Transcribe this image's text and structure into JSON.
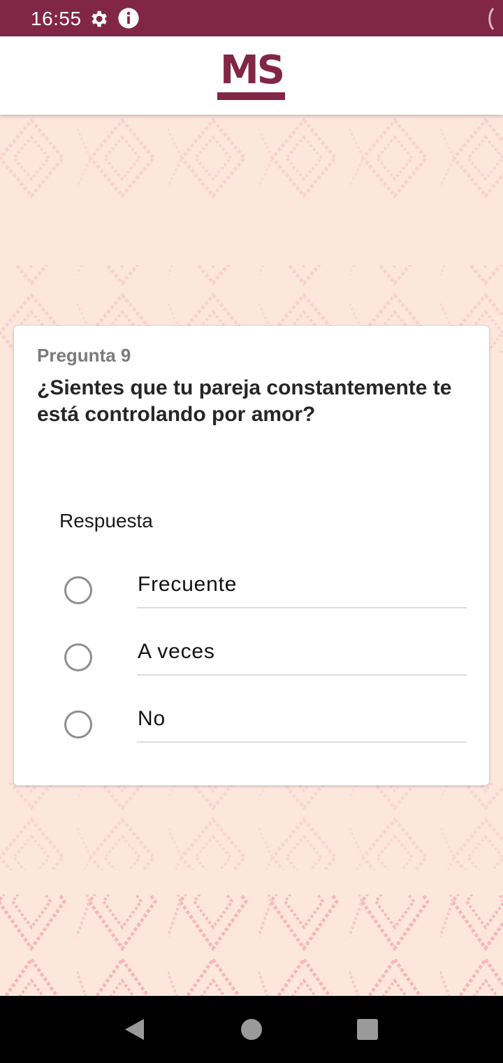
{
  "status_bar": {
    "time": "16:55",
    "icons": [
      "gear-icon",
      "info-icon"
    ],
    "background": "#822645"
  },
  "app_bar": {
    "logo_text": "MS",
    "brand_color": "#822645"
  },
  "question": {
    "number_label": "Pregunta 9",
    "text": "¿Sientes que tu pareja constantemente te está controlando por amor?"
  },
  "answers": {
    "label": "Respuesta",
    "options": [
      {
        "label": "Frecuente",
        "selected": false
      },
      {
        "label": "A veces",
        "selected": false
      },
      {
        "label": "No",
        "selected": false
      }
    ]
  },
  "nav_bar": {
    "icons": [
      "back-icon",
      "home-icon",
      "recent-apps-icon"
    ]
  },
  "colors": {
    "background": "#fde7dc",
    "pattern": "#f6bdc3"
  }
}
